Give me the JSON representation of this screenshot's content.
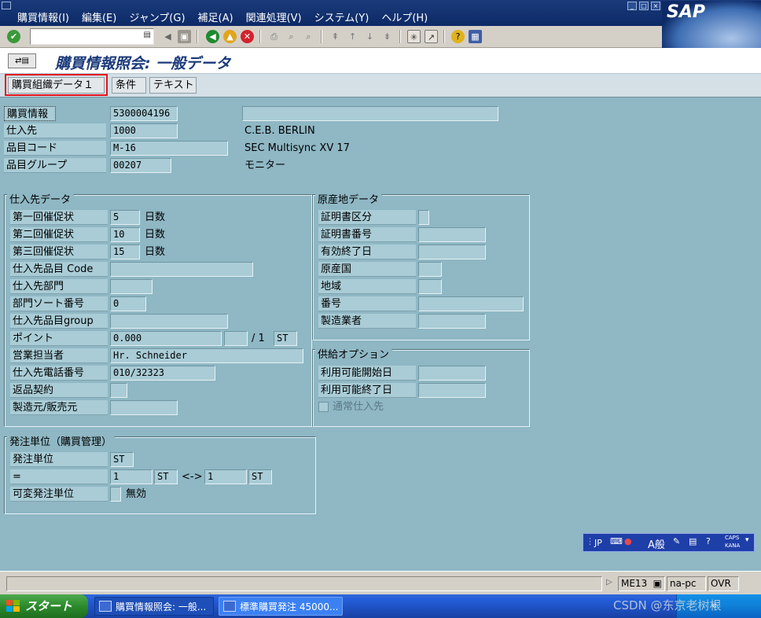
{
  "menubar": {
    "items": [
      "購買情報(I)",
      "編集(E)",
      "ジャンプ(G)",
      "補足(A)",
      "関連処理(V)",
      "システム(Y)",
      "ヘルプ(H)"
    ],
    "logo": "SAP"
  },
  "toolbar": {
    "command_value": ""
  },
  "title": {
    "text": "購買情報照会: 一般データ"
  },
  "tabs": [
    {
      "label": "購買組織データ１",
      "active": true
    },
    {
      "label": "条件",
      "active": false
    },
    {
      "label": "テキスト",
      "active": false
    }
  ],
  "header": {
    "info_record_label": "購買情報",
    "info_record_value": "5300004196",
    "info_record_text": "",
    "vendor_label": "仕入先",
    "vendor_value": "1000",
    "vendor_text": "C.E.B. BERLIN",
    "material_label": "品目コード",
    "material_value": "M-16",
    "material_text": "SEC Multisync XV 17",
    "matgroup_label": "品目グループ",
    "matgroup_value": "00207",
    "matgroup_text": "モニター"
  },
  "vendor_data": {
    "title": "仕入先データ",
    "reminder1_label": "第一回催促状",
    "reminder1_value": "5",
    "reminder1_unit": "日数",
    "reminder2_label": "第二回催促状",
    "reminder2_value": "10",
    "reminder2_unit": "日数",
    "reminder3_label": "第三回催促状",
    "reminder3_value": "15",
    "reminder3_unit": "日数",
    "vendor_mat_label": "仕入先品目 Code",
    "vendor_mat_value": "",
    "subrange_label": "仕入先部門",
    "subrange_value": "",
    "sort_label": "部門ソート番号",
    "sort_value": "0",
    "vendor_matgroup_label": "仕入先品目group",
    "vendor_matgroup_value": "",
    "points_label": "ポイント",
    "points_value": "0.000",
    "points_extra": "",
    "points_per": "/ 1",
    "points_unit": "ST",
    "salesperson_label": "営業担当者",
    "salesperson_value": "Hr. Schneider",
    "phone_label": "仕入先電話番号",
    "phone_value": "010/32323",
    "return_label": "返品契約",
    "return_value": "",
    "mfr_label": "製造元/販売元",
    "mfr_value": ""
  },
  "origin_data": {
    "title": "原産地データ",
    "cert_cat_label": "証明書区分",
    "cert_cat_value": "",
    "cert_no_label": "証明書番号",
    "cert_no_value": "",
    "valid_to_label": "有効終了日",
    "valid_to_value": "",
    "country_label": "原産国",
    "country_value": "",
    "region_label": "地域",
    "region_value": "",
    "number_label": "番号",
    "number_value": "",
    "manufacturer_label": "製造業者",
    "manufacturer_value": ""
  },
  "supply_options": {
    "title": "供給オプション",
    "avail_from_label": "利用可能開始日",
    "avail_from_value": "",
    "avail_to_label": "利用可能終了日",
    "avail_to_value": "",
    "regular_vendor_label": "通常仕入先"
  },
  "order_unit": {
    "title": "発注単位（購買管理）",
    "unit_label": "発注単位",
    "unit_value": "ST",
    "conv_label": "=",
    "conv_qty1": "1",
    "conv_unit1": "ST",
    "conv_arrow": "<->",
    "conv_qty2": "1",
    "conv_unit2": "ST",
    "var_label": "可変発注単位",
    "var_value": "",
    "var_text": "無効"
  },
  "langbar": {
    "lang": "JP",
    "mode": "A般",
    "caps": "CAPS",
    "kana": "KANA"
  },
  "statusbar": {
    "tcode": "ME13",
    "server": "na-pc",
    "mode": "OVR"
  },
  "taskbar": {
    "start": "スタート",
    "task1": "購買情報照会: 一般...",
    "task2": "標準購買発注 45000...",
    "watermark": "CSDN @东京老树根"
  },
  "colors": {
    "screen_bg": "#8fb7c4",
    "title_color": "#1b3a7b",
    "active_tab_outline": "#e3141c"
  }
}
